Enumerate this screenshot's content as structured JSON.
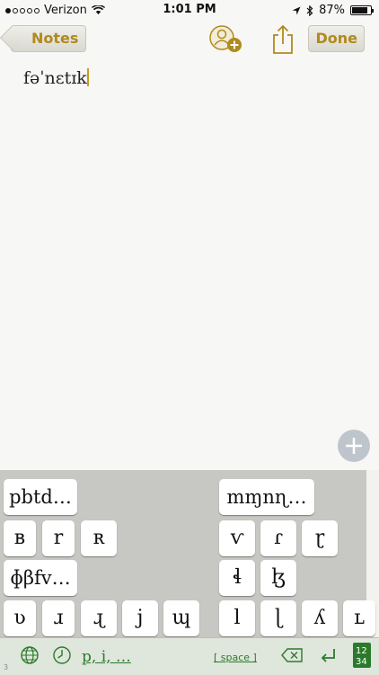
{
  "status_bar": {
    "carrier": "Verizon",
    "time": "1:01 PM",
    "battery_percent": "87%",
    "battery_level": 0.87
  },
  "nav": {
    "back_label": "Notes",
    "done_label": "Done"
  },
  "note": {
    "text": "fəˈnɛtɪk"
  },
  "keyboard": {
    "row1": [
      "pbtd…",
      "mɱnɳ…"
    ],
    "row2_left": [
      "ʙ",
      "r",
      "ʀ"
    ],
    "row2_right": [
      "ⱱ",
      "ɾ",
      "ɽ"
    ],
    "row3_left": [
      "ɸβfv…"
    ],
    "row3_right": [
      "ɬ",
      "ɮ"
    ],
    "row4_left": [
      "ʋ",
      "ɹ",
      "ɻ",
      "j",
      "ɰ"
    ],
    "row4_right": [
      "l",
      "ɭ",
      "ʎ",
      "ʟ"
    ]
  },
  "toolbar": {
    "vowels_label": "p, i, …",
    "space_label": "[ space ]",
    "small_label": "3"
  },
  "icons": [
    "globe-icon",
    "clock-icon",
    "backspace-icon",
    "return-icon",
    "numbers-icon",
    "add-contact-icon",
    "share-icon",
    "plus-icon",
    "location-icon",
    "bluetooth-icon",
    "wifi-icon"
  ]
}
